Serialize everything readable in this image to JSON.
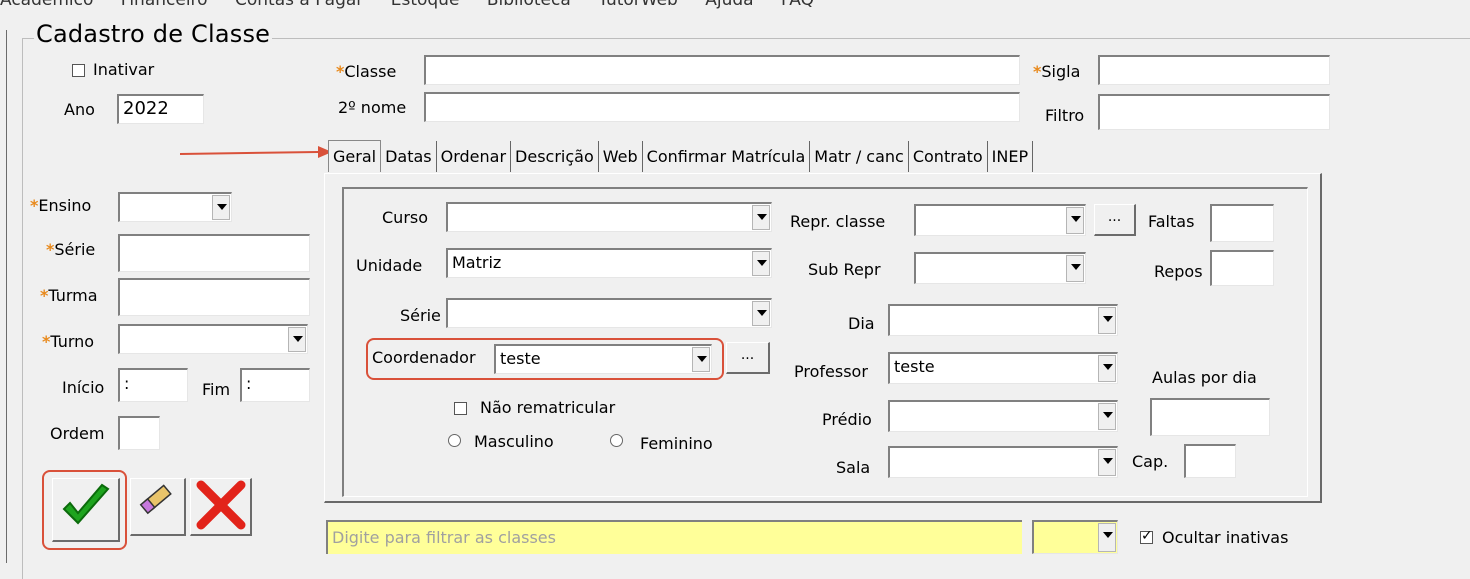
{
  "menu": [
    "Acadêmico",
    "Financeiro",
    "Contas a Pagar",
    "Estoque",
    "Biblioteca",
    "TutorWeb",
    "Ajuda",
    "FAQ"
  ],
  "form": {
    "title": "Cadastro de Classe",
    "inativar_label": "Inativar",
    "ano_label": "Ano",
    "ano_value": "2022",
    "classe_label": "Classe",
    "classe_value": "",
    "segundo_nome_label": "2º nome",
    "sigla_label": "Sigla",
    "filtro_label": "Filtro",
    "ensino_label": "Ensino",
    "serie_label": "Série",
    "turma_label": "Turma",
    "turno_label": "Turno",
    "inicio_label": "Início",
    "inicio_value": ":",
    "fim_label": "Fim",
    "fim_value": ":",
    "ordem_label": "Ordem"
  },
  "tabs": [
    "Geral",
    "Datas",
    "Ordenar",
    "Descrição",
    "Web",
    "Confirmar Matrícula",
    "Matr / canc",
    "Contrato",
    "INEP"
  ],
  "geral": {
    "curso_label": "Curso",
    "unidade_label": "Unidade",
    "unidade_value": "Matriz",
    "serie_label": "Série",
    "coordenador_label": "Coordenador",
    "coordenador_value": "teste",
    "ellipsis": "...",
    "nao_rematricular_label": "Não rematricular",
    "masculino_label": "Masculino",
    "feminino_label": "Feminino",
    "repr_classe_label": "Repr. classe",
    "faltas_label": "Faltas",
    "sub_repr_label": "Sub Repr",
    "repos_label": "Repos",
    "dia_label": "Dia",
    "professor_label": "Professor",
    "professor_value": "teste",
    "aulas_por_dia_label": "Aulas por dia",
    "predio_label": "Prédio",
    "sala_label": "Sala",
    "cap_label": "Cap."
  },
  "bottom": {
    "filter_placeholder": "Digite para filtrar as classes",
    "ocultar_inativas_label": "Ocultar inativas"
  },
  "colors": {
    "required_star": "#e8891c",
    "highlight_box": "#d9513a",
    "filter_bg": "#ffff99"
  }
}
